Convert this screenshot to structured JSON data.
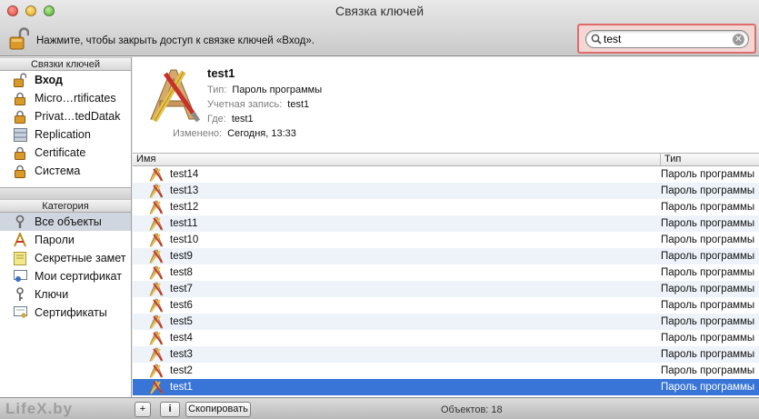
{
  "window": {
    "title": "Связка ключей"
  },
  "toolbar": {
    "lock_message": "Нажмите, чтобы закрыть доступ к связке ключей «Вход».",
    "search_value": "test"
  },
  "sidebar": {
    "keychains_header": "Связки ключей",
    "keychains": [
      {
        "label": "Вход",
        "icon": "lock-open-icon"
      },
      {
        "label": "Micro…rtificates",
        "icon": "lock-icon"
      },
      {
        "label": "Privat…tedDatak",
        "icon": "lock-icon"
      },
      {
        "label": "Replication",
        "icon": "cabinet-icon"
      },
      {
        "label": "Certificate",
        "icon": "lock-icon"
      },
      {
        "label": "Система",
        "icon": "lock-icon"
      }
    ],
    "category_header": "Категория",
    "categories": [
      {
        "label": "Все объекты",
        "icon": "all-items-icon"
      },
      {
        "label": "Пароли",
        "icon": "password-icon"
      },
      {
        "label": "Секретные замет",
        "icon": "secure-note-icon"
      },
      {
        "label": "Мои сертификат",
        "icon": "my-certificates-icon"
      },
      {
        "label": "Ключи",
        "icon": "key-icon"
      },
      {
        "label": "Сертификаты",
        "icon": "certificate-icon"
      }
    ]
  },
  "detail": {
    "name": "test1",
    "type_label": "Тип:",
    "type_value": "Пароль программы",
    "account_label": "Учетная запись:",
    "account_value": "test1",
    "where_label": "Где:",
    "where_value": "test1",
    "modified_label": "Изменено:",
    "modified_value": "Сегодня, 13:33"
  },
  "table": {
    "col_name": "Имя",
    "col_type": "Тип",
    "rows": [
      {
        "name": "test14",
        "type": "Пароль программы"
      },
      {
        "name": "test13",
        "type": "Пароль программы"
      },
      {
        "name": "test12",
        "type": "Пароль программы"
      },
      {
        "name": "test11",
        "type": "Пароль программы"
      },
      {
        "name": "test10",
        "type": "Пароль программы"
      },
      {
        "name": "test9",
        "type": "Пароль программы"
      },
      {
        "name": "test8",
        "type": "Пароль программы"
      },
      {
        "name": "test7",
        "type": "Пароль программы"
      },
      {
        "name": "test6",
        "type": "Пароль программы"
      },
      {
        "name": "test5",
        "type": "Пароль программы"
      },
      {
        "name": "test4",
        "type": "Пароль программы"
      },
      {
        "name": "test3",
        "type": "Пароль программы"
      },
      {
        "name": "test2",
        "type": "Пароль программы"
      },
      {
        "name": "test1",
        "type": "Пароль программы"
      }
    ]
  },
  "bottombar": {
    "add_label": "+",
    "info_label": "i",
    "copy_label": "Скопировать",
    "count_text": "Объектов: 18",
    "watermark": "LifeX.by"
  },
  "colors": {
    "selection": "#3875d7",
    "search_highlight": "#e06b6b"
  }
}
